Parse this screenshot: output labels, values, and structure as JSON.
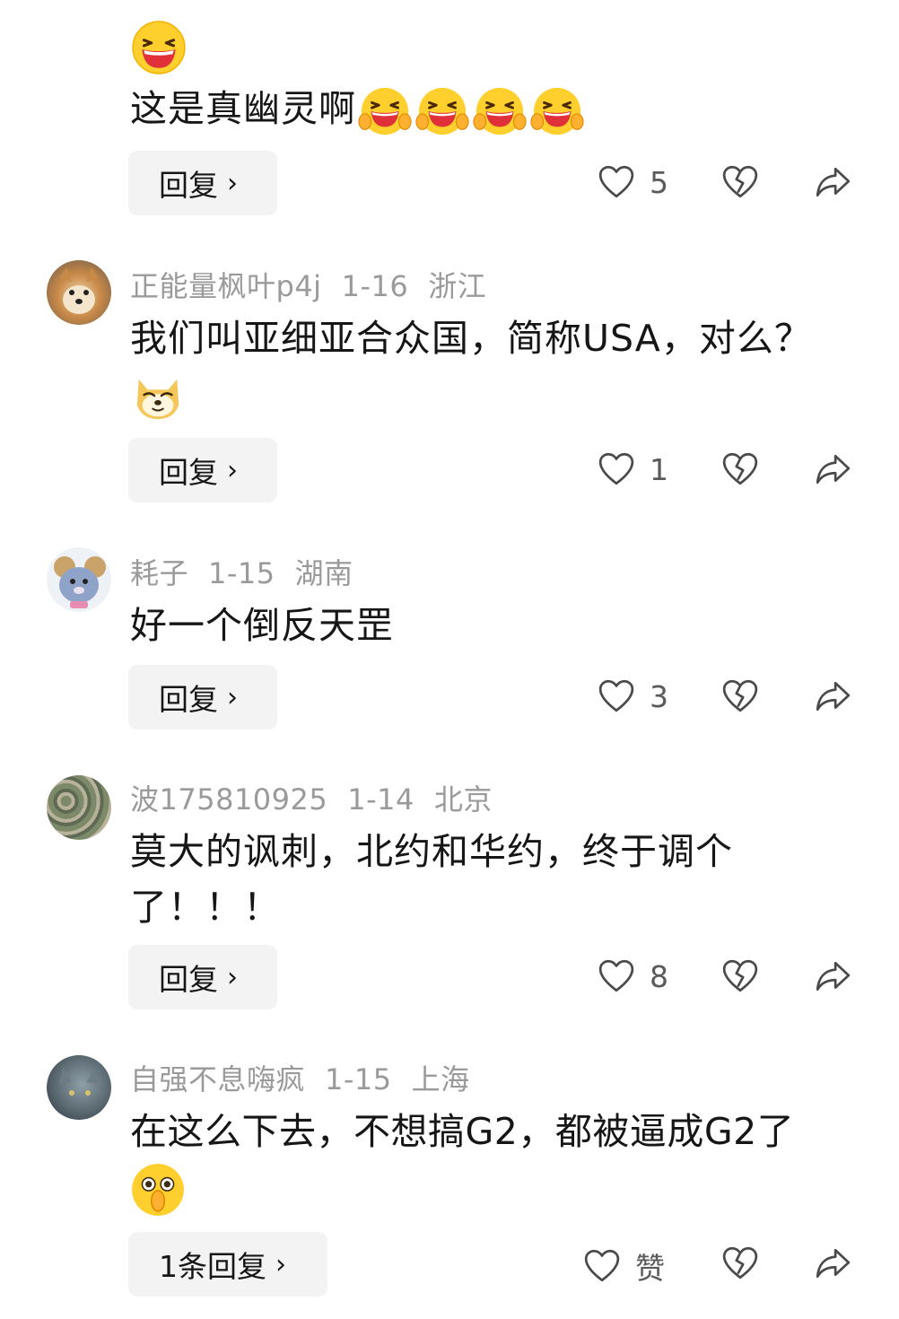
{
  "comments": [
    {
      "text": "这是真幽灵啊",
      "reply_label": "回复",
      "likes": "5"
    },
    {
      "username": "正能量枫叶p4j",
      "date": "1-16",
      "location": "浙江",
      "text": "我们叫亚细亚合众国，简称USA，对么？",
      "reply_label": "回复",
      "likes": "1"
    },
    {
      "username": "耗子",
      "date": "1-15",
      "location": "湖南",
      "text": "好一个倒反天罡",
      "reply_label": "回复",
      "likes": "3"
    },
    {
      "username": "波175810925",
      "date": "1-14",
      "location": "北京",
      "text": "莫大的讽刺，北约和华约，终于调个了！！！",
      "reply_label": "回复",
      "likes": "8"
    },
    {
      "username": "自强不息嗨疯",
      "date": "1-15",
      "location": "上海",
      "text": "在这么下去，不想搞G2，都被逼成G2了",
      "reply_label": "1条回复",
      "likes": "赞"
    }
  ],
  "icons": {
    "like": "heart-outline-icon",
    "dislike": "broken-heart-icon",
    "share": "share-arrow-icon"
  }
}
